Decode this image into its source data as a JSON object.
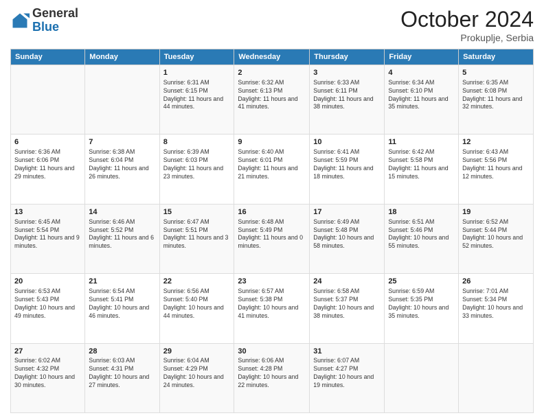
{
  "header": {
    "logo_line1": "General",
    "logo_line2": "Blue",
    "month": "October 2024",
    "location": "Prokuplje, Serbia"
  },
  "weekdays": [
    "Sunday",
    "Monday",
    "Tuesday",
    "Wednesday",
    "Thursday",
    "Friday",
    "Saturday"
  ],
  "weeks": [
    [
      {
        "day": "",
        "info": ""
      },
      {
        "day": "",
        "info": ""
      },
      {
        "day": "1",
        "info": "Sunrise: 6:31 AM\nSunset: 6:15 PM\nDaylight: 11 hours and 44 minutes."
      },
      {
        "day": "2",
        "info": "Sunrise: 6:32 AM\nSunset: 6:13 PM\nDaylight: 11 hours and 41 minutes."
      },
      {
        "day": "3",
        "info": "Sunrise: 6:33 AM\nSunset: 6:11 PM\nDaylight: 11 hours and 38 minutes."
      },
      {
        "day": "4",
        "info": "Sunrise: 6:34 AM\nSunset: 6:10 PM\nDaylight: 11 hours and 35 minutes."
      },
      {
        "day": "5",
        "info": "Sunrise: 6:35 AM\nSunset: 6:08 PM\nDaylight: 11 hours and 32 minutes."
      }
    ],
    [
      {
        "day": "6",
        "info": "Sunrise: 6:36 AM\nSunset: 6:06 PM\nDaylight: 11 hours and 29 minutes."
      },
      {
        "day": "7",
        "info": "Sunrise: 6:38 AM\nSunset: 6:04 PM\nDaylight: 11 hours and 26 minutes."
      },
      {
        "day": "8",
        "info": "Sunrise: 6:39 AM\nSunset: 6:03 PM\nDaylight: 11 hours and 23 minutes."
      },
      {
        "day": "9",
        "info": "Sunrise: 6:40 AM\nSunset: 6:01 PM\nDaylight: 11 hours and 21 minutes."
      },
      {
        "day": "10",
        "info": "Sunrise: 6:41 AM\nSunset: 5:59 PM\nDaylight: 11 hours and 18 minutes."
      },
      {
        "day": "11",
        "info": "Sunrise: 6:42 AM\nSunset: 5:58 PM\nDaylight: 11 hours and 15 minutes."
      },
      {
        "day": "12",
        "info": "Sunrise: 6:43 AM\nSunset: 5:56 PM\nDaylight: 11 hours and 12 minutes."
      }
    ],
    [
      {
        "day": "13",
        "info": "Sunrise: 6:45 AM\nSunset: 5:54 PM\nDaylight: 11 hours and 9 minutes."
      },
      {
        "day": "14",
        "info": "Sunrise: 6:46 AM\nSunset: 5:52 PM\nDaylight: 11 hours and 6 minutes."
      },
      {
        "day": "15",
        "info": "Sunrise: 6:47 AM\nSunset: 5:51 PM\nDaylight: 11 hours and 3 minutes."
      },
      {
        "day": "16",
        "info": "Sunrise: 6:48 AM\nSunset: 5:49 PM\nDaylight: 11 hours and 0 minutes."
      },
      {
        "day": "17",
        "info": "Sunrise: 6:49 AM\nSunset: 5:48 PM\nDaylight: 10 hours and 58 minutes."
      },
      {
        "day": "18",
        "info": "Sunrise: 6:51 AM\nSunset: 5:46 PM\nDaylight: 10 hours and 55 minutes."
      },
      {
        "day": "19",
        "info": "Sunrise: 6:52 AM\nSunset: 5:44 PM\nDaylight: 10 hours and 52 minutes."
      }
    ],
    [
      {
        "day": "20",
        "info": "Sunrise: 6:53 AM\nSunset: 5:43 PM\nDaylight: 10 hours and 49 minutes."
      },
      {
        "day": "21",
        "info": "Sunrise: 6:54 AM\nSunset: 5:41 PM\nDaylight: 10 hours and 46 minutes."
      },
      {
        "day": "22",
        "info": "Sunrise: 6:56 AM\nSunset: 5:40 PM\nDaylight: 10 hours and 44 minutes."
      },
      {
        "day": "23",
        "info": "Sunrise: 6:57 AM\nSunset: 5:38 PM\nDaylight: 10 hours and 41 minutes."
      },
      {
        "day": "24",
        "info": "Sunrise: 6:58 AM\nSunset: 5:37 PM\nDaylight: 10 hours and 38 minutes."
      },
      {
        "day": "25",
        "info": "Sunrise: 6:59 AM\nSunset: 5:35 PM\nDaylight: 10 hours and 35 minutes."
      },
      {
        "day": "26",
        "info": "Sunrise: 7:01 AM\nSunset: 5:34 PM\nDaylight: 10 hours and 33 minutes."
      }
    ],
    [
      {
        "day": "27",
        "info": "Sunrise: 6:02 AM\nSunset: 4:32 PM\nDaylight: 10 hours and 30 minutes."
      },
      {
        "day": "28",
        "info": "Sunrise: 6:03 AM\nSunset: 4:31 PM\nDaylight: 10 hours and 27 minutes."
      },
      {
        "day": "29",
        "info": "Sunrise: 6:04 AM\nSunset: 4:29 PM\nDaylight: 10 hours and 24 minutes."
      },
      {
        "day": "30",
        "info": "Sunrise: 6:06 AM\nSunset: 4:28 PM\nDaylight: 10 hours and 22 minutes."
      },
      {
        "day": "31",
        "info": "Sunrise: 6:07 AM\nSunset: 4:27 PM\nDaylight: 10 hours and 19 minutes."
      },
      {
        "day": "",
        "info": ""
      },
      {
        "day": "",
        "info": ""
      }
    ]
  ]
}
